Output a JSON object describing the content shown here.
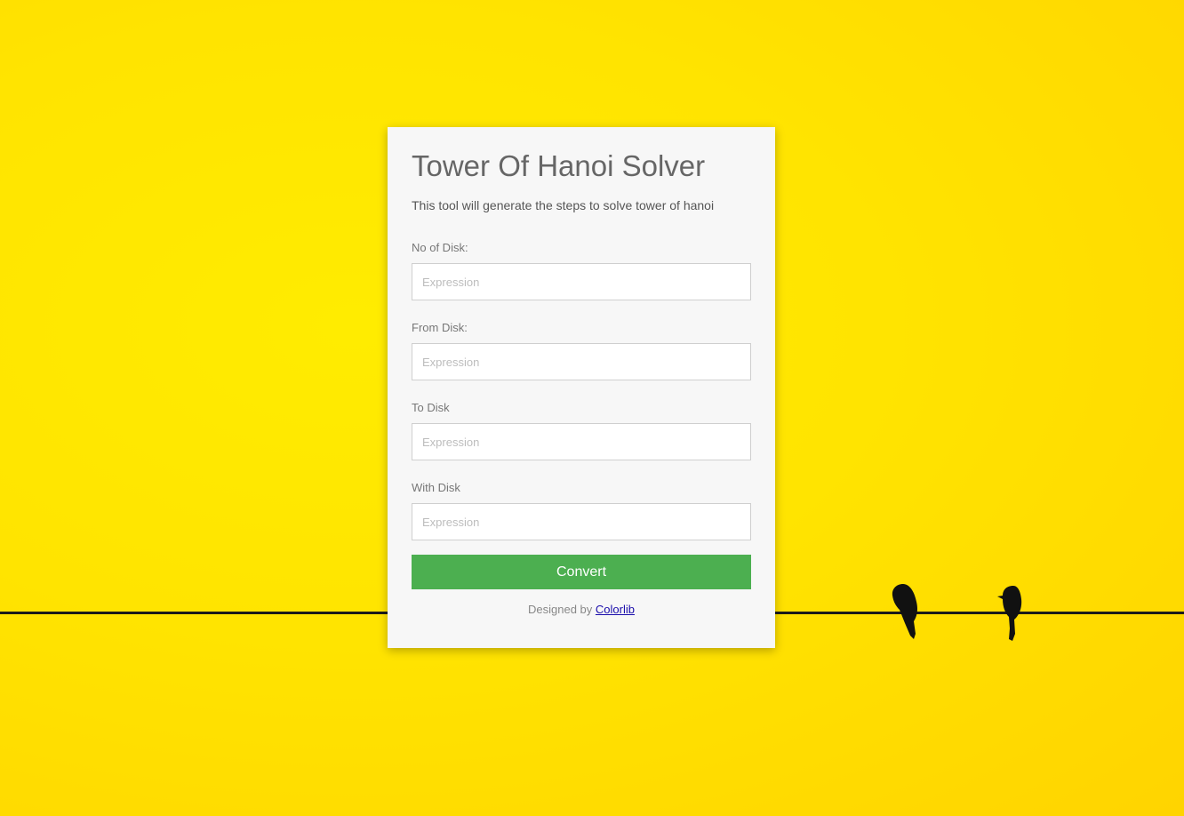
{
  "page": {
    "background_color": "#ffe400"
  },
  "form": {
    "title": "Tower Of Hanoi Solver",
    "subtitle": "This tool will generate the steps to solve tower of hanoi",
    "fields": [
      {
        "label": "No of Disk:",
        "placeholder": "Expression",
        "value": ""
      },
      {
        "label": "From Disk:",
        "placeholder": "Expression",
        "value": ""
      },
      {
        "label": "To Disk",
        "placeholder": "Expression",
        "value": ""
      },
      {
        "label": "With Disk",
        "placeholder": "Expression",
        "value": ""
      }
    ],
    "submit_label": "Convert",
    "submit_color": "#4caf50"
  },
  "footer": {
    "credit_prefix": "Designed by",
    "credit_link": "Colorlib"
  }
}
